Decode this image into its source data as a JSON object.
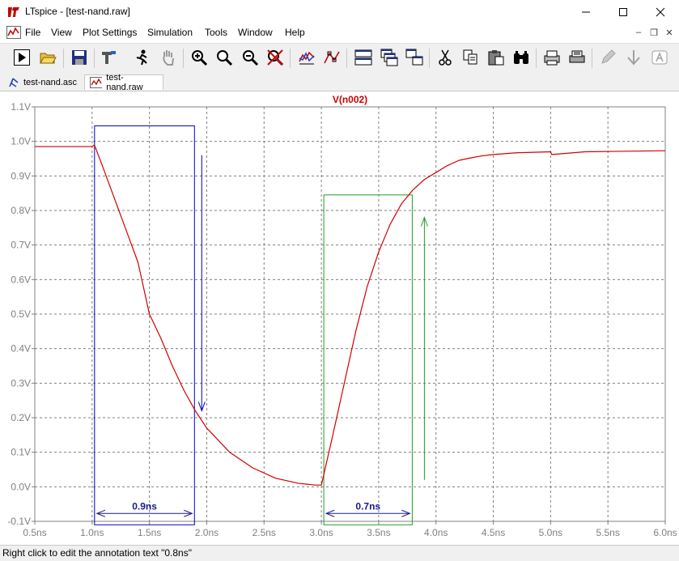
{
  "window": {
    "title": "LTspice - [test-nand.raw]"
  },
  "menu": [
    "File",
    "View",
    "Plot Settings",
    "Simulation",
    "Tools",
    "Window",
    "Help"
  ],
  "tabs": [
    {
      "label": "test-nand.asc",
      "icon": "schematic-icon",
      "active": false
    },
    {
      "label": "test-nand.raw",
      "icon": "waveform-icon",
      "active": true
    }
  ],
  "toolbar_icons": [
    "run-icon",
    "open-icon",
    "save-icon",
    "control-panel-icon",
    "halt-icon",
    "pan-icon",
    "zoom-in-icon",
    "zoom-box-icon",
    "zoom-out-icon",
    "zoom-cancel-icon",
    "autorange-icon",
    "mark-icon",
    "tile-horizontal-icon",
    "cascade-icon",
    "tile-vertical-icon",
    "cut-icon",
    "copy-icon",
    "paste-icon",
    "find-icon",
    "print-preview-icon",
    "print-icon",
    "pencil-icon",
    "down-arrow-icon",
    "text-icon"
  ],
  "status": "Right click to edit the annotation text \"0.8ns\"",
  "colors": {
    "trace": "#d00000",
    "fall_box": "#0000c0",
    "rise_box": "#20a020",
    "grid": "#808080"
  },
  "chart_data": {
    "type": "line",
    "title": "V(n002)",
    "xlabel": "",
    "ylabel": "",
    "x_unit": "ns",
    "y_unit": "V",
    "xlim": [
      0.5,
      6.0
    ],
    "ylim": [
      -0.1,
      1.1
    ],
    "grid": true,
    "x_ticks": [
      "0.5ns",
      "1.0ns",
      "1.5ns",
      "2.0ns",
      "2.5ns",
      "3.0ns",
      "3.5ns",
      "4.0ns",
      "4.5ns",
      "5.0ns",
      "5.5ns",
      "6.0ns"
    ],
    "y_ticks": [
      "1.1V",
      "1.0V",
      "0.9V",
      "0.8V",
      "0.7V",
      "0.6V",
      "0.5V",
      "0.4V",
      "0.3V",
      "0.2V",
      "0.1V",
      "0.0V",
      "-0.1V"
    ],
    "series": [
      {
        "name": "V(n002)",
        "x": [
          0.5,
          1.0,
          1.02,
          1.1,
          1.2,
          1.3,
          1.4,
          1.5,
          1.6,
          1.7,
          1.8,
          1.9,
          2.0,
          2.2,
          2.4,
          2.6,
          2.8,
          2.95,
          3.0,
          3.1,
          3.2,
          3.3,
          3.4,
          3.5,
          3.6,
          3.7,
          3.8,
          3.9,
          4.0,
          4.1,
          4.2,
          4.3,
          4.4,
          4.5,
          4.7,
          5.0,
          5.01,
          5.3,
          6.0
        ],
        "y": [
          0.985,
          0.985,
          0.99,
          0.92,
          0.83,
          0.74,
          0.65,
          0.5,
          0.43,
          0.35,
          0.28,
          0.22,
          0.17,
          0.1,
          0.055,
          0.025,
          0.01,
          0.005,
          0.005,
          0.15,
          0.3,
          0.45,
          0.58,
          0.68,
          0.76,
          0.82,
          0.86,
          0.89,
          0.91,
          0.93,
          0.945,
          0.952,
          0.958,
          0.962,
          0.967,
          0.97,
          0.962,
          0.97,
          0.973
        ]
      }
    ],
    "annotations": [
      {
        "label": "0.9ns",
        "kind": "fall",
        "x_start": 1.0,
        "x_end": 1.9,
        "y_top": 1.045,
        "y_bottom": -0.11,
        "arrow_y_from": 0.96,
        "arrow_y_to": 0.22
      },
      {
        "label": "0.7ns",
        "kind": "rise",
        "x_start": 3.0,
        "x_end": 3.8,
        "y_top": 0.845,
        "y_bottom": -0.11,
        "arrow_y_from": 0.02,
        "arrow_y_to": 0.78
      }
    ]
  }
}
